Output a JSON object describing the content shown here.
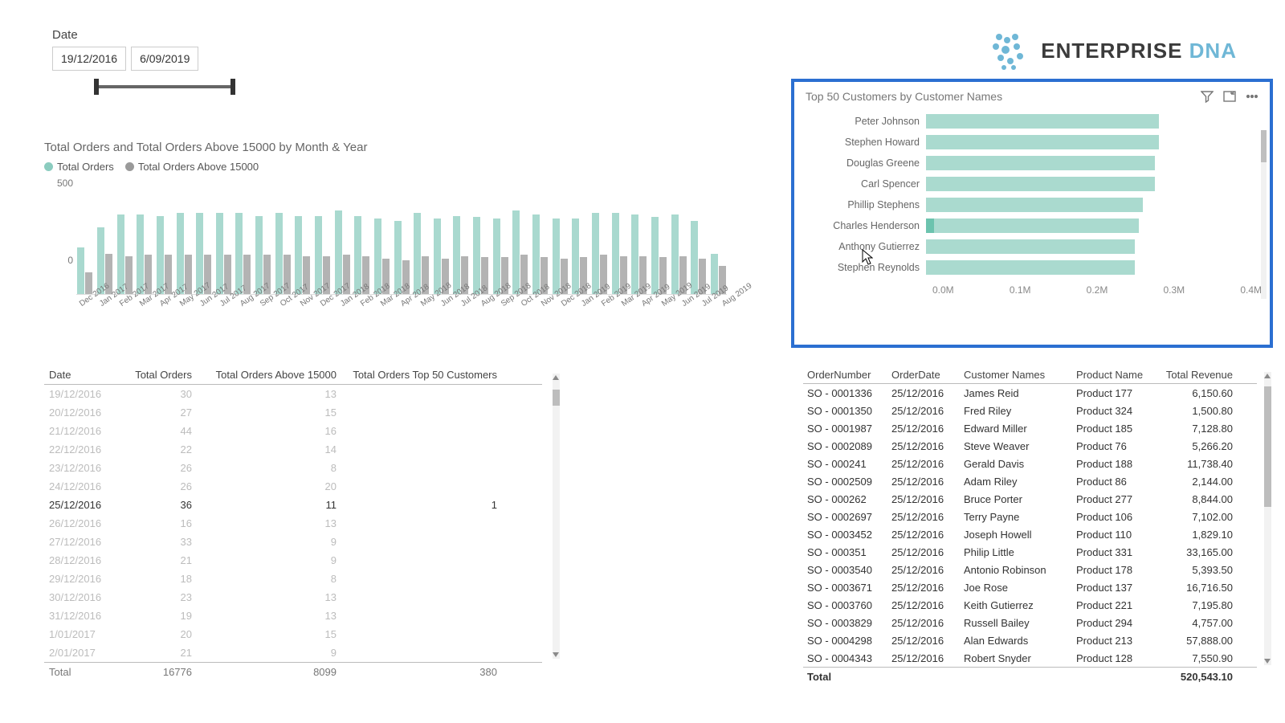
{
  "slicer": {
    "label": "Date",
    "start": "19/12/2016",
    "end": "6/09/2019"
  },
  "brand": {
    "name": "ENTERPRISE",
    "accent": "DNA"
  },
  "colChart": {
    "title": "Total Orders and Total Orders Above 15000 by Month & Year",
    "legend": {
      "a": "Total Orders",
      "b": "Total Orders Above 15000"
    },
    "yticks": [
      "500",
      "0"
    ]
  },
  "top50": {
    "title": "Top 50 Customers by Customer Names",
    "xticks": [
      "0.0M",
      "0.1M",
      "0.2M",
      "0.3M",
      "0.4M"
    ]
  },
  "leftTable": {
    "headers": [
      "Date",
      "Total Orders",
      "Total Orders Above 15000",
      "Total Orders Top 50 Customers"
    ],
    "footer": [
      "Total",
      "16776",
      "8099",
      "380"
    ]
  },
  "rightTable": {
    "headers": [
      "OrderNumber",
      "OrderDate",
      "Customer Names",
      "Product Name",
      "Total Revenue"
    ],
    "footerLabel": "Total",
    "footerValue": "520,543.10"
  },
  "chart_data": [
    {
      "type": "bar",
      "title": "Total Orders and Total Orders Above 15000 by Month & Year",
      "orientation": "vertical",
      "categories": [
        "Dec 2016",
        "Jan 2017",
        "Feb 2017",
        "Mar 2017",
        "Apr 2017",
        "May 2017",
        "Jun 2017",
        "Jul 2017",
        "Aug 2017",
        "Sep 2017",
        "Oct 2017",
        "Nov 2017",
        "Dec 2017",
        "Jan 2018",
        "Feb 2018",
        "Mar 2018",
        "Apr 2018",
        "May 2018",
        "Jun 2018",
        "Jul 2018",
        "Aug 2018",
        "Sep 2018",
        "Oct 2018",
        "Nov 2018",
        "Dec 2018",
        "Jan 2019",
        "Feb 2019",
        "Mar 2019",
        "Apr 2019",
        "May 2019",
        "Jun 2019",
        "Jul 2019",
        "Aug 2019"
      ],
      "series": [
        {
          "name": "Total Orders",
          "values": [
            370,
            530,
            630,
            630,
            620,
            640,
            640,
            640,
            640,
            620,
            640,
            620,
            620,
            660,
            620,
            600,
            580,
            640,
            600,
            620,
            610,
            600,
            660,
            630,
            600,
            600,
            640,
            640,
            630,
            610,
            630,
            580,
            320
          ]
        },
        {
          "name": "Total Orders Above 15000",
          "values": [
            170,
            320,
            300,
            310,
            310,
            310,
            310,
            310,
            310,
            310,
            310,
            300,
            300,
            310,
            300,
            280,
            270,
            300,
            280,
            300,
            290,
            290,
            310,
            290,
            280,
            290,
            310,
            300,
            300,
            290,
            300,
            280,
            220
          ]
        }
      ],
      "xlabel": "",
      "ylabel": "",
      "ylim": [
        0,
        700
      ],
      "colors": {
        "Total Orders": "#8bccbf",
        "Total Orders Above 15000": "#9a9a9a"
      }
    },
    {
      "type": "bar",
      "title": "Top 50 Customers by Customer Names",
      "orientation": "horizontal",
      "categories": [
        "Peter Johnson",
        "Stephen Howard",
        "Douglas Greene",
        "Carl Spencer",
        "Phillip Stephens",
        "Charles Henderson",
        "Anthony Gutierrez",
        "Stephen Reynolds"
      ],
      "values": [
        290000,
        290000,
        285000,
        285000,
        270000,
        265000,
        260000,
        260000
      ],
      "highlight": {
        "category": "Charles Henderson",
        "value": 10000
      },
      "xlabel": "",
      "ylabel": "",
      "xlim": [
        0,
        400000
      ],
      "xticks": [
        "0.0M",
        "0.1M",
        "0.2M",
        "0.3M",
        "0.4M"
      ],
      "color": "#aadacf"
    },
    {
      "type": "table",
      "title": "Daily orders",
      "columns": [
        "Date",
        "Total Orders",
        "Total Orders Above 15000",
        "Total Orders Top 50 Customers"
      ],
      "rows": [
        [
          "19/12/2016",
          30,
          13,
          null
        ],
        [
          "20/12/2016",
          27,
          15,
          null
        ],
        [
          "21/12/2016",
          44,
          16,
          null
        ],
        [
          "22/12/2016",
          22,
          14,
          null
        ],
        [
          "23/12/2016",
          26,
          8,
          null
        ],
        [
          "24/12/2016",
          26,
          20,
          null
        ],
        [
          "25/12/2016",
          36,
          11,
          1
        ],
        [
          "26/12/2016",
          16,
          13,
          null
        ],
        [
          "27/12/2016",
          33,
          9,
          null
        ],
        [
          "28/12/2016",
          21,
          9,
          null
        ],
        [
          "29/12/2016",
          18,
          8,
          null
        ],
        [
          "30/12/2016",
          23,
          13,
          null
        ],
        [
          "31/12/2016",
          19,
          13,
          null
        ],
        [
          "1/01/2017",
          20,
          15,
          null
        ],
        [
          "2/01/2017",
          21,
          9,
          null
        ]
      ],
      "selected_row_index": 6,
      "totals": [
        "Total",
        16776,
        8099,
        380
      ]
    },
    {
      "type": "table",
      "title": "Order detail",
      "columns": [
        "OrderNumber",
        "OrderDate",
        "Customer Names",
        "Product Name",
        "Total Revenue"
      ],
      "rows": [
        [
          "SO - 0001336",
          "25/12/2016",
          "James Reid",
          "Product 177",
          6150.6
        ],
        [
          "SO - 0001350",
          "25/12/2016",
          "Fred Riley",
          "Product 324",
          1500.8
        ],
        [
          "SO - 0001987",
          "25/12/2016",
          "Edward Miller",
          "Product 185",
          7128.8
        ],
        [
          "SO - 0002089",
          "25/12/2016",
          "Steve Weaver",
          "Product 76",
          5266.2
        ],
        [
          "SO - 000241",
          "25/12/2016",
          "Gerald Davis",
          "Product 188",
          11738.4
        ],
        [
          "SO - 0002509",
          "25/12/2016",
          "Adam Riley",
          "Product 86",
          2144.0
        ],
        [
          "SO - 000262",
          "25/12/2016",
          "Bruce Porter",
          "Product 277",
          8844.0
        ],
        [
          "SO - 0002697",
          "25/12/2016",
          "Terry Payne",
          "Product 106",
          7102.0
        ],
        [
          "SO - 0003452",
          "25/12/2016",
          "Joseph Howell",
          "Product 110",
          1829.1
        ],
        [
          "SO - 000351",
          "25/12/2016",
          "Philip Little",
          "Product 331",
          33165.0
        ],
        [
          "SO - 0003540",
          "25/12/2016",
          "Antonio Robinson",
          "Product 178",
          5393.5
        ],
        [
          "SO - 0003671",
          "25/12/2016",
          "Joe Rose",
          "Product 137",
          16716.5
        ],
        [
          "SO - 0003760",
          "25/12/2016",
          "Keith Gutierrez",
          "Product 221",
          7195.8
        ],
        [
          "SO - 0003829",
          "25/12/2016",
          "Russell Bailey",
          "Product 294",
          4757.0
        ],
        [
          "SO - 0004298",
          "25/12/2016",
          "Alan Edwards",
          "Product 213",
          57888.0
        ],
        [
          "SO - 0004343",
          "25/12/2016",
          "Robert Snyder",
          "Product 128",
          7550.9
        ]
      ],
      "totals": [
        "Total",
        null,
        null,
        null,
        520543.1
      ]
    }
  ]
}
